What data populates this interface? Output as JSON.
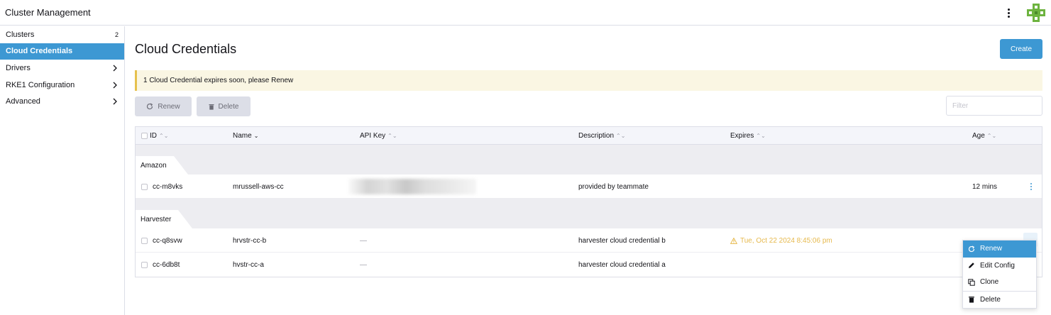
{
  "header": {
    "title": "Cluster Management"
  },
  "sidebar": {
    "items": [
      {
        "label": "Clusters",
        "count": "2"
      },
      {
        "label": "Cloud Credentials"
      },
      {
        "label": "Drivers"
      },
      {
        "label": "RKE1 Configuration"
      },
      {
        "label": "Advanced"
      }
    ]
  },
  "main": {
    "title": "Cloud Credentials",
    "create_label": "Create",
    "banner": "1 Cloud Credential expires soon, please Renew",
    "renew_label": "Renew",
    "delete_label": "Delete",
    "filter_placeholder": "Filter"
  },
  "table": {
    "columns": {
      "id": "ID",
      "name": "Name",
      "apikey": "API Key",
      "description": "Description",
      "expires": "Expires",
      "age": "Age"
    },
    "groups": [
      {
        "name": "Amazon",
        "rows": [
          {
            "id": "cc-m8vks",
            "name": "mrussell-aws-cc",
            "description": "provided by teammate",
            "age": "12 mins"
          }
        ]
      },
      {
        "name": "Harvester",
        "rows": [
          {
            "id": "cc-q8svw",
            "name": "hrvstr-cc-b",
            "apikey": "—",
            "description": "harvester cloud credential b",
            "expires": "Tue, Oct 22 2024 8:45:06 pm"
          },
          {
            "id": "cc-6db8t",
            "name": "hvstr-cc-a",
            "apikey": "—",
            "description": "harvester cloud credential a"
          }
        ]
      }
    ]
  },
  "context_menu": {
    "items": [
      {
        "label": "Renew"
      },
      {
        "label": "Edit Config"
      },
      {
        "label": "Clone"
      },
      {
        "label": "Delete"
      }
    ]
  },
  "colors": {
    "accent": "#3d98d3",
    "warning": "#e6b94d",
    "banner_bg": "#faf6e3"
  }
}
